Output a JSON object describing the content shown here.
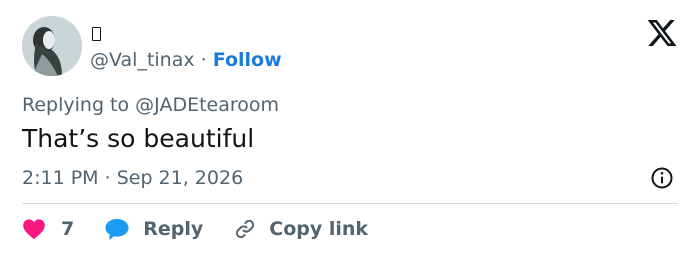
{
  "author": {
    "display_name_glyph": "▯",
    "handle": "@Val_tinax",
    "separator": "·",
    "follow_label": "Follow"
  },
  "reply_to": {
    "prefix": "Replying to",
    "handle": "@JADEtearoom"
  },
  "tweet": {
    "text": "That’s so beautiful",
    "time": "2:11 PM",
    "separator": "·",
    "date": "Sep 21, 2026"
  },
  "actions": {
    "like_count": "7",
    "reply_label": "Reply",
    "copy_link_label": "Copy link"
  },
  "icons": [
    "x-logo-icon",
    "info-icon",
    "heart-icon",
    "speech-bubble-icon",
    "link-icon"
  ],
  "colors": {
    "follow_blue": "#1d7bd8",
    "heart_pink": "#f91880",
    "reply_bubble_blue": "#1d9bf0",
    "secondary_text": "#536471",
    "divider": "#cfd9de"
  }
}
